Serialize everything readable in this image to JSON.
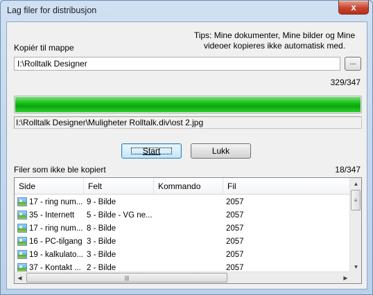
{
  "window": {
    "title": "Lag filer for distribusjon",
    "close_glyph": "x"
  },
  "tips": "Tips: Mine dokumenter, Mine bilder og Mine videoer kopieres ikke automatisk med.",
  "copy_to": {
    "label": "Kopiér til mappe",
    "value": "I:\\Rolltalk Designer",
    "browse_label": "..."
  },
  "progress": {
    "count": "329/347",
    "fraction": 1.0,
    "color": "#0aa80a",
    "current_file": "I:\\Rolltalk Designer\\Muligheter Rolltalk.div\\ost 2.jpg"
  },
  "buttons": {
    "start": "Start",
    "close": "Lukk"
  },
  "not_copied": {
    "label": "Filer som ikke ble kopiert",
    "count": "18/347",
    "columns": [
      "Side",
      "Felt",
      "Kommando",
      "Fil"
    ],
    "rows": [
      {
        "side": "17 - ring num...",
        "felt": "9 - Bilde",
        "kommando": "",
        "fil": "2057",
        "icon": "image-icon"
      },
      {
        "side": "35 - Internett",
        "felt": "5 - Bilde - VG ne...",
        "kommando": "",
        "fil": "2057",
        "icon": "image-icon"
      },
      {
        "side": "17 - ring num...",
        "felt": "8 - Bilde",
        "kommando": "",
        "fil": "2057",
        "icon": "image-icon"
      },
      {
        "side": "16 - PC-tilgang",
        "felt": "3 - Bilde",
        "kommando": "",
        "fil": "2057",
        "icon": "image-icon"
      },
      {
        "side": "19 - kalkulato...",
        "felt": "3 - Bilde",
        "kommando": "",
        "fil": "2057",
        "icon": "image-icon"
      },
      {
        "side": "37 - Kontakt ...",
        "felt": "2 - Bilde",
        "kommando": "",
        "fil": "2057",
        "icon": "image-icon"
      }
    ]
  }
}
